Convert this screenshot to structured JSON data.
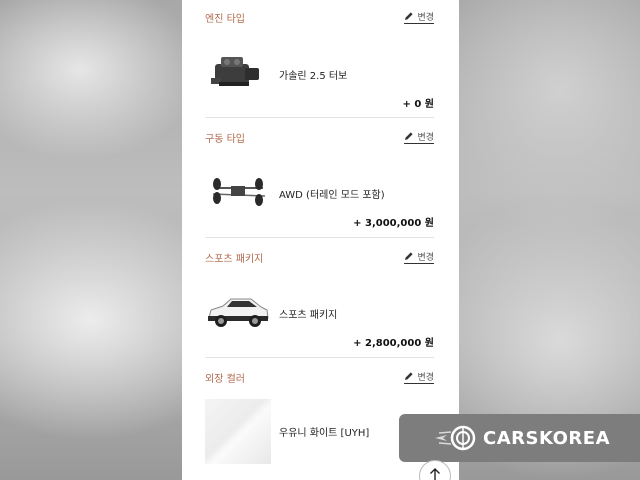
{
  "sections": [
    {
      "title": "엔진 타입",
      "change_label": "변경",
      "item_name": "가솔린 2.5 터보",
      "price": "+ 0 원",
      "image": "engine-icon"
    },
    {
      "title": "구동 타입",
      "change_label": "변경",
      "item_name": "AWD (터레인 모드 포함)",
      "price": "+ 3,000,000 원",
      "image": "drivetrain-icon"
    },
    {
      "title": "스포츠 패키지",
      "change_label": "변경",
      "item_name": "스포츠 패키지",
      "price": "+ 2,800,000 원",
      "image": "suv-car-icon"
    },
    {
      "title": "외장 컬러",
      "change_label": "변경",
      "item_name": "우유니 화이트 [UYH]",
      "image": "color-swatch",
      "swatch_color": "#efefef"
    }
  ],
  "watermark": {
    "brand": "CARSKOREA"
  },
  "colors": {
    "section_title": "#b06a4c",
    "badge_bg": "#7d7d7d"
  }
}
